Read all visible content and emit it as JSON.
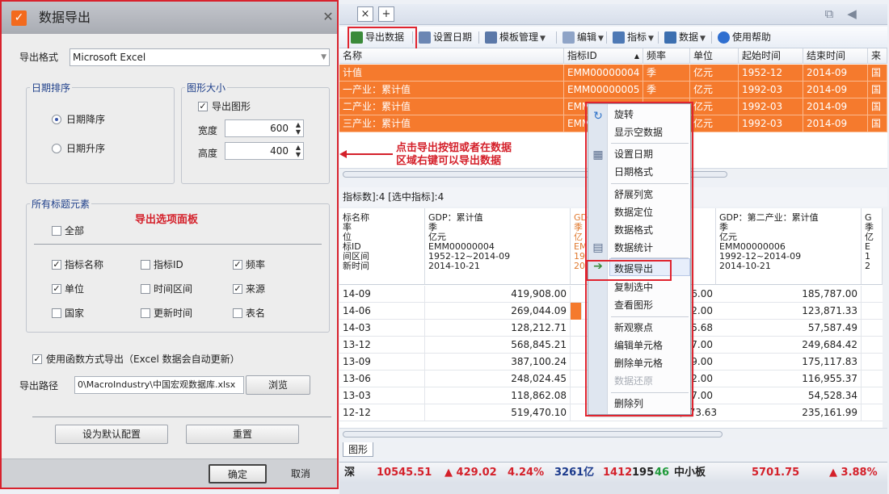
{
  "dialog": {
    "title": "数据导出",
    "close_glyph": "✕",
    "format_label": "导出格式",
    "format_value": "Microsoft Excel",
    "date_sort": {
      "legend": "日期排序",
      "desc": "日期降序",
      "asc": "日期升序"
    },
    "chart_size": {
      "legend": "图形大小",
      "export_chart": "导出图形",
      "width_label": "宽度",
      "width_value": "600",
      "height_label": "高度",
      "height_value": "400"
    },
    "title_elements": {
      "legend": "所有标题元素",
      "all": "全部",
      "hint": "导出选项面板",
      "options": [
        {
          "label": "指标名称",
          "checked": true
        },
        {
          "label": "指标ID",
          "checked": false
        },
        {
          "label": "频率",
          "checked": true
        },
        {
          "label": "单位",
          "checked": true
        },
        {
          "label": "时间区间",
          "checked": false
        },
        {
          "label": "来源",
          "checked": true
        },
        {
          "label": "国家",
          "checked": false
        },
        {
          "label": "更新时间",
          "checked": false
        },
        {
          "label": "表名",
          "checked": false
        }
      ]
    },
    "use_function": "使用函数方式导出（Excel 数据会自动更新）",
    "path_label": "导出路径",
    "path_value": "0\\MacroIndustry\\中国宏观数据库.xlsx",
    "browse": "浏览",
    "set_default": "设为默认配置",
    "reset": "重置",
    "ok": "确定",
    "cancel": "取消"
  },
  "toolbar": {
    "export": "导出数据",
    "set_date": "设置日期",
    "template": "模板管理",
    "edit": "编辑",
    "indicator": "指标",
    "data": "数据",
    "help": "使用帮助"
  },
  "top_grid": {
    "headers": [
      "名称",
      "指标ID",
      "频率",
      "单位",
      "起始时间",
      "结束时间",
      "来"
    ],
    "rows": [
      [
        "计值",
        "EMM00000004",
        "季",
        "亿元",
        "1952-12",
        "2014-09",
        "国"
      ],
      [
        "一产业：累计值",
        "EMM00000005",
        "季",
        "亿元",
        "1992-03",
        "2014-09",
        "国"
      ],
      [
        "二产业：累计值",
        "EMM",
        "",
        "亿元",
        "1992-03",
        "2014-09",
        "国"
      ],
      [
        "三产业：累计值",
        "EMM",
        "",
        "亿元",
        "1992-03",
        "2014-09",
        "国"
      ]
    ]
  },
  "annotation": "点击导出按钮或者在数据\n区域右键可以导出数据",
  "stats": "指标数]:4  [选中指标]:4",
  "bottom_grid": {
    "col0_header": "标名称\n率\n位\n标ID\n间区间\n新时间",
    "col1_header": "GDP：累计值\n季\n亿元\nEMM00000004\n1952-12~2014-09\n2014-10-21",
    "col2_header": "GD\n季\n亿\nEM\n19\n20",
    "col4_header": "GDP：第二产业：累计值\n季\n亿元\nEMM00000006\n1992-12~2014-09\n2014-10-21",
    "col5_header": "G\n季\n亿\nE\n1\n2",
    "rows": [
      {
        "date": "14-09",
        "v1": "419,908.00",
        "v3": "6.00",
        "v4": "185,787.00"
      },
      {
        "date": "14-06",
        "v1": "269,044.09",
        "v3": "2.00",
        "v4": "123,871.33"
      },
      {
        "date": "14-03",
        "v1": "128,212.71",
        "v3": "5.68",
        "v4": "57,587.49"
      },
      {
        "date": "13-12",
        "v1": "568,845.21",
        "v3": "7.00",
        "v4": "249,684.42"
      },
      {
        "date": "13-09",
        "v1": "387,100.24",
        "v3": "9.00",
        "v4": "175,117.83"
      },
      {
        "date": "13-06",
        "v1": "248,024.45",
        "v3": "2.00",
        "v4": "116,955.37"
      },
      {
        "date": "13-03",
        "v1": "118,862.08",
        "v3": "7.00",
        "v4": "54,528.34"
      },
      {
        "date": "12-12",
        "v1": "519,470.10",
        "v3": "52,373.63",
        "v4": "235,161.99"
      }
    ]
  },
  "sheet_tab": "图形",
  "ticker": {
    "index": "深",
    "price": "10545.51",
    "change": "▲ 429.02",
    "pct": "4.24%",
    "vol": "3261亿",
    "rise": "1412",
    "flat": "195",
    "fall": "46",
    "board": "中小板",
    "board_price": "5701.75",
    "board_pct": "▲ 3.88%"
  },
  "context_menu": {
    "items": [
      {
        "label": "旋转",
        "disabled": false
      },
      {
        "label": "显示空数据",
        "disabled": false
      },
      {
        "label": "设置日期",
        "disabled": false
      },
      {
        "label": "日期格式",
        "disabled": false
      },
      {
        "label": "舒展列宽",
        "disabled": false
      },
      {
        "label": "数据定位",
        "disabled": false
      },
      {
        "label": "数据格式",
        "disabled": false
      },
      {
        "label": "数据统计",
        "disabled": false
      },
      {
        "label": "数据导出",
        "disabled": false
      },
      {
        "label": "复制选中",
        "disabled": false
      },
      {
        "label": "查看图形",
        "disabled": false
      },
      {
        "label": "新观察点",
        "disabled": false
      },
      {
        "label": "编辑单元格",
        "disabled": false
      },
      {
        "label": "删除单元格",
        "disabled": false
      },
      {
        "label": "数据还原",
        "disabled": true
      },
      {
        "label": "删除列",
        "disabled": false
      }
    ]
  },
  "colors": {
    "accent_red": "#e0242f",
    "row_orange": "#f57a2d",
    "up_red": "#d4202a",
    "link_blue": "#1e3f8a"
  }
}
